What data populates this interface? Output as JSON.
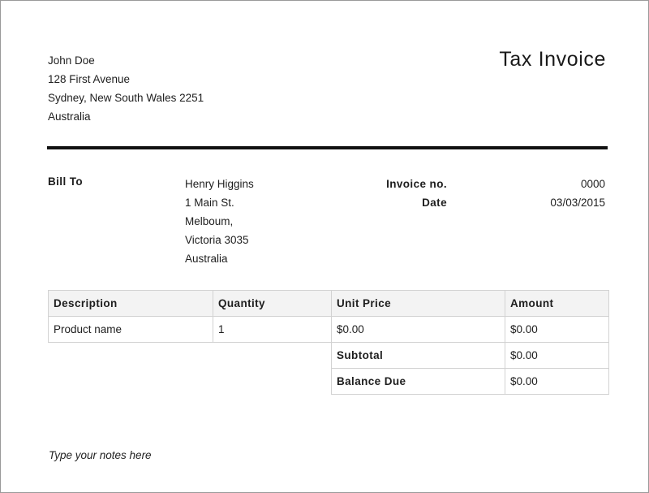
{
  "sender": {
    "name": "John Doe",
    "address_line1": "128 First Avenue",
    "address_line2": "Sydney, New South Wales 2251",
    "country": "Australia"
  },
  "title": "Tax Invoice",
  "bill_to": {
    "label": "Bill To",
    "name": "Henry Higgins",
    "line1": "1 Main St.",
    "line2": "Melboum,",
    "line3": "Victoria 3035",
    "country": "Australia"
  },
  "invoice": {
    "number_label": "Invoice no.",
    "number": "0000",
    "date_label": "Date",
    "date": "03/03/2015"
  },
  "table": {
    "headers": [
      "Description",
      "Quantity",
      "Unit Price",
      "Amount"
    ],
    "rows": [
      {
        "description": "Product name",
        "quantity": "1",
        "unit_price": "$0.00",
        "amount": "$0.00"
      }
    ],
    "subtotal_label": "Subtotal",
    "subtotal": "$0.00",
    "balance_label": "Balance Due",
    "balance": "$0.00"
  },
  "notes": "Type your notes here"
}
